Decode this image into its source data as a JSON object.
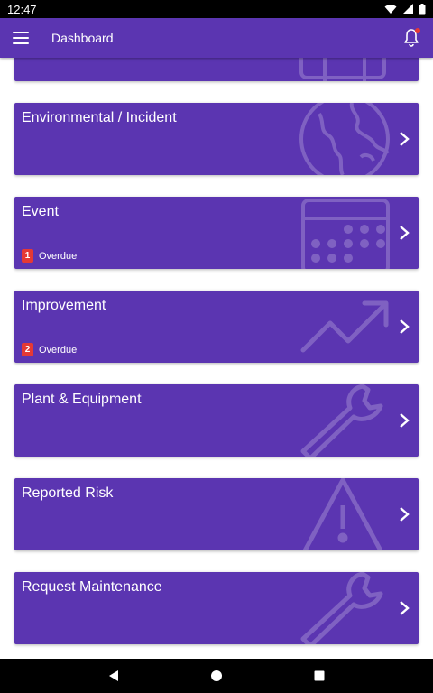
{
  "status_bar": {
    "time": "12:47"
  },
  "app_bar": {
    "title": "Dashboard",
    "menu_icon": "menu-icon",
    "notification_icon": "bell-icon"
  },
  "colors": {
    "primary": "#5b35b1",
    "badge": "#e53935"
  },
  "cards": [
    {
      "title": "",
      "icon": "calendar-icon"
    },
    {
      "title": "Environmental / Incident",
      "icon": "globe-icon"
    },
    {
      "title": "Event",
      "icon": "calendar-icon",
      "badge": "1",
      "badge_label": "Overdue"
    },
    {
      "title": "Improvement",
      "icon": "trend-up-icon",
      "badge": "2",
      "badge_label": "Overdue"
    },
    {
      "title": "Plant & Equipment",
      "icon": "wrench-icon"
    },
    {
      "title": "Reported Risk",
      "icon": "warning-icon"
    },
    {
      "title": "Request Maintenance",
      "icon": "wrench-icon"
    }
  ]
}
